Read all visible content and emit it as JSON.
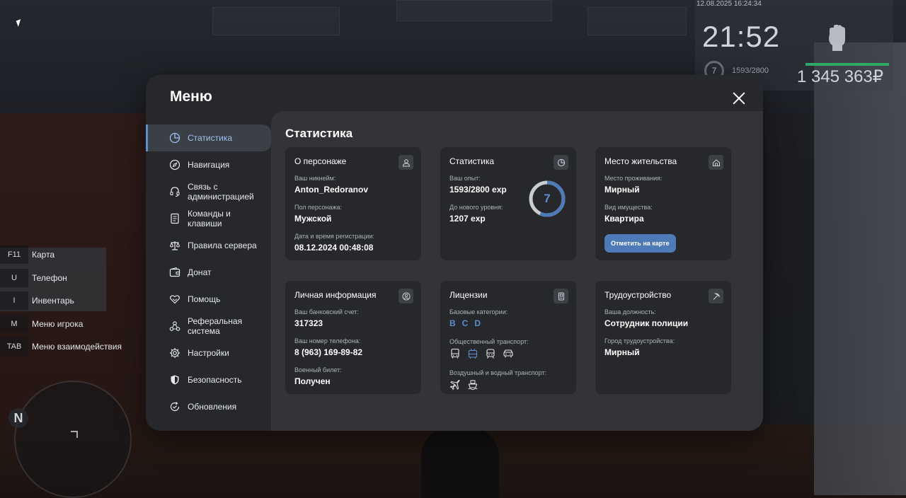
{
  "hud": {
    "datetime": "12.08.2025 16:24:34",
    "clock": "21:52",
    "level": "7",
    "exp": "1593/2800",
    "money": "1 345 363₽"
  },
  "keybinds": [
    {
      "key": "F11",
      "label": "Карта"
    },
    {
      "key": "U",
      "label": "Телефон"
    },
    {
      "key": "I",
      "label": "Инвентарь"
    },
    {
      "key": "M",
      "label": "Меню игрока"
    },
    {
      "key": "TAB",
      "label": "Меню взаимодействия"
    }
  ],
  "minimap": {
    "compass": "N"
  },
  "menu": {
    "title": "Меню",
    "sidebar": [
      {
        "label": "Статистика",
        "icon": "pie-chart-icon",
        "active": true
      },
      {
        "label": "Навигация",
        "icon": "compass-icon"
      },
      {
        "label": "Связь с администрацией",
        "icon": "headset-icon"
      },
      {
        "label": "Команды и клавиши",
        "icon": "document-icon"
      },
      {
        "label": "Правила сервера",
        "icon": "scales-icon"
      },
      {
        "label": "Донат",
        "icon": "wallet-icon"
      },
      {
        "label": "Помощь",
        "icon": "heart-hands-icon"
      },
      {
        "label": "Реферальная система",
        "icon": "people-network-icon"
      },
      {
        "label": "Настройки",
        "icon": "gear-icon"
      },
      {
        "label": "Безопасность",
        "icon": "shield-icon"
      },
      {
        "label": "Обновления",
        "icon": "refresh-check-icon"
      }
    ],
    "content_title": "Статистика",
    "cards": {
      "character": {
        "title": "О персонаже",
        "nickname_label": "Ваш никнейм:",
        "nickname": "Anton_Redoranov",
        "gender_label": "Пол персонажа:",
        "gender": "Мужской",
        "reg_label": "Дата и время регистрации:",
        "reg": "08.12.2024 00:48:08"
      },
      "stats": {
        "title": "Статистика",
        "exp_label": "Ваш опыт:",
        "exp": "1593/2800 exp",
        "next_label": "До нового уровня:",
        "next": "1207 exp",
        "level": "7",
        "progress": 0.569
      },
      "residence": {
        "title": "Место жительства",
        "place_label": "Место проживания:",
        "place": "Мирный",
        "property_label": "Вид имущества:",
        "property": "Квартира",
        "button": "Отметить на карте"
      },
      "personal": {
        "title": "Личная информация",
        "bank_label": "Ваш банковский счет:",
        "bank": "317323",
        "phone_label": "Ваш номер телефона:",
        "phone": "8 (963) 169-89-82",
        "military_label": "Военный билет:",
        "military": "Получен"
      },
      "licenses": {
        "title": "Лицензии",
        "base_label": "Базовые категории:",
        "base": [
          "B",
          "C",
          "D"
        ],
        "public_label": "Общественный транспорт:",
        "air_label": "Воздушный и водный транспорт:"
      },
      "job": {
        "title": "Трудоустройство",
        "position_label": "Ваша должность:",
        "position": "Сотрудник полиции",
        "city_label": "Город трудоустройства:",
        "city": "Мирный"
      }
    }
  },
  "colors": {
    "accent": "#5d8ed0",
    "button": "#4f7ab8",
    "panel": "#26282b",
    "content": "#323437"
  }
}
